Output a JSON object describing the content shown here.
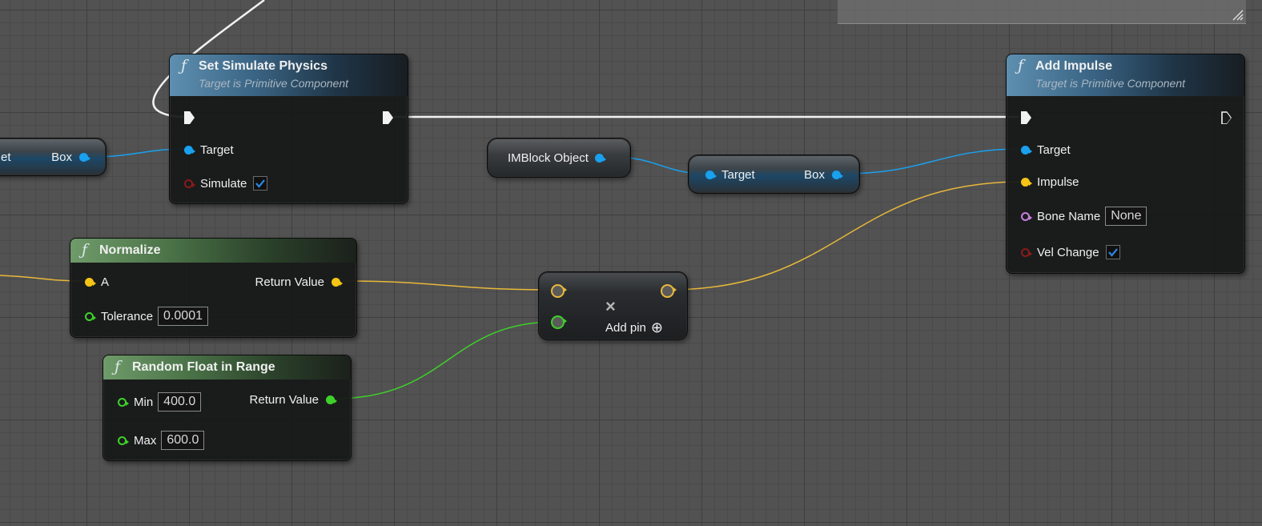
{
  "nodes": {
    "set_simulate_physics": {
      "title": "Set Simulate Physics",
      "subtitle": "Target is Primitive Component",
      "target_label": "Target",
      "simulate_label": "Simulate",
      "simulate_checked": true
    },
    "add_impulse": {
      "title": "Add Impulse",
      "subtitle": "Target is Primitive Component",
      "target_label": "Target",
      "impulse_label": "Impulse",
      "bone_name_label": "Bone Name",
      "bone_name_value": "None",
      "vel_change_label": "Vel Change",
      "vel_change_checked": true
    },
    "normalize": {
      "title": "Normalize",
      "a_label": "A",
      "return_label": "Return Value",
      "tolerance_label": "Tolerance",
      "tolerance_value": "0.0001"
    },
    "random_float": {
      "title": "Random Float in Range",
      "min_label": "Min",
      "min_value": "400.0",
      "max_label": "Max",
      "max_value": "600.0",
      "return_label": "Return Value"
    },
    "left_getter": {
      "left_text": "et",
      "box_label": "Box"
    },
    "imblock_object": {
      "label": "IMBlock Object"
    },
    "target_box_getter": {
      "target_label": "Target",
      "box_label": "Box"
    },
    "multiply": {
      "op_symbol": "×",
      "add_pin_label": "Add pin",
      "add_pin_icon": "⊕"
    }
  },
  "colors": {
    "object_pin": "#19a1f0",
    "vector_pin": "#f5c414",
    "float_pin": "#3ed12a",
    "bool_pin": "#8b1a1a",
    "name_pin": "#c97ee0",
    "exec_wire": "#f2f2f2"
  },
  "icons": {
    "function": "function-icon",
    "exec": "exec-pin-icon",
    "check": "checkmark-icon",
    "multiply": "multiply-icon",
    "add": "plus-circle-icon"
  }
}
